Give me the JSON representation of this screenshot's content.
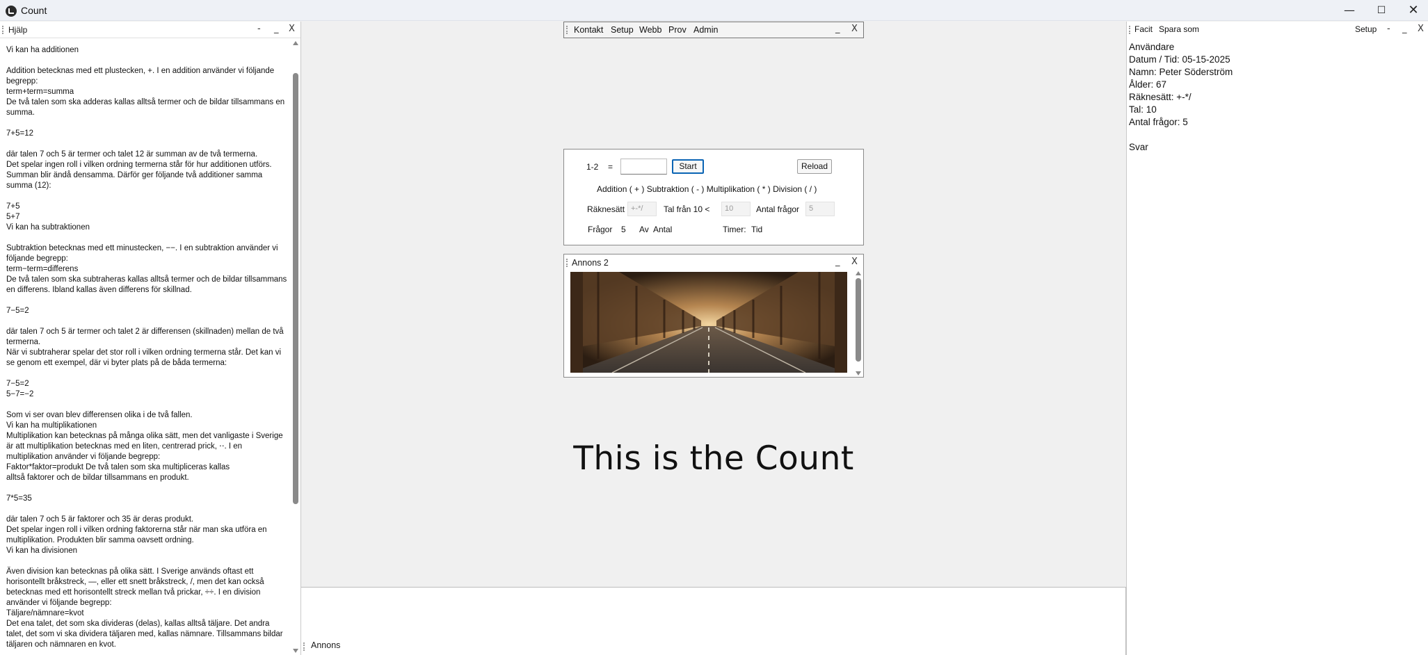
{
  "window": {
    "title": "Count",
    "minimize": "—",
    "maximize": "☐",
    "close": "✕"
  },
  "help_pane": {
    "title": "Hjälp",
    "controls": [
      "-",
      "_",
      "X"
    ],
    "text": "Vi kan ha additionen\n\nAddition betecknas med ett plustecken, +. I en addition använder vi följande begrepp:\nterm+term=summa\nDe två talen som ska adderas kallas alltså termer och de bildar tillsammans en summa.\n\n7+5=12\n\ndär talen 7 och 5 är termer och talet 12 är summan av de två termerna.\nDet spelar ingen roll i vilken ordning termerna står för hur additionen utförs. Summan blir ändå densamma. Därför ger följande två additioner samma summa (12):\n\n7+5\n5+7\nVi kan ha subtraktionen\n\nSubtraktion betecknas med ett minustecken, −−. I en subtraktion använder vi följande begrepp:\nterm−term=differens\nDe två talen som ska subtraheras kallas alltså termer och de bildar tillsammans en differens. Ibland kallas även differens för skillnad.\n\n7−5=2\n\ndär talen 7 och 5 är termer och talet 2 är differensen (skillnaden) mellan de två termerna.\nNär vi subtraherar spelar det stor roll i vilken ordning termerna står. Det kan vi se genom ett exempel, där vi byter plats på de båda termerna:\n\n7−5=2\n5−7=−2\n\nSom vi ser ovan blev differensen olika i de två fallen.\nVi kan ha multiplikationen\nMultiplikation kan betecknas på många olika sätt, men det vanligaste i Sverige är att multiplikation betecknas med en liten, centrerad prick, ⋅⋅. I en multiplikation använder vi följande begrepp:\nFaktor*faktor=produkt De två talen som ska multipliceras kallas\nalltså faktorer och de bildar tillsammans en produkt.\n\n7*5=35\n\ndär talen 7 och 5 är faktorer och 35 är deras produkt.\nDet spelar ingen roll i vilken ordning faktorerna står när man ska utföra en multiplikation. Produkten blir samma oavsett ordning.\nVi kan ha divisionen\n\nÄven division kan betecknas på olika sätt. I Sverige används oftast ett horisontellt bråkstreck, —, eller ett snett bråkstreck, /, men det kan också betecknas med ett horisontellt streck mellan två prickar, ÷÷. I en division använder vi följande begrepp:\nTäljare/nämnare=kvot\nDet ena talet, det som ska divideras (delas), kallas alltså täljare. Det andra talet, det som vi ska dividera täljaren med, kallas nämnare. Tillsammans bildar täljaren och nämnaren en kvot."
  },
  "menu_pane": {
    "items": [
      "Kontakt",
      "Setup",
      "Webb",
      "Prov",
      "Admin"
    ],
    "controls": [
      "_",
      "X"
    ]
  },
  "calc": {
    "question": "1-2",
    "equals": "=",
    "answer_value": "",
    "start_label": "Start",
    "reload_label": "Reload",
    "operations_line": "Addition ( + ) Subtraktion ( - ) Multiplikation ( * ) Division ( / )",
    "raknesatt_label": "Räknesätt",
    "raknesatt_value": "+-*/",
    "tal_fran_label": "Tal från 10 <",
    "tal_fran_value": "10",
    "antal_fragor_label": "Antal frågor",
    "antal_fragor_value": "5",
    "fragor_label": "Frågor",
    "fragor_value": "5",
    "av_label": "Av",
    "antal_label": "Antal",
    "timer_label": "Timer:",
    "tid_label": "Tid"
  },
  "ad2_pane": {
    "title": "Annons 2",
    "controls": [
      "_",
      "X"
    ]
  },
  "main_title": "This is the Count",
  "bottom_pane": {
    "title": "Annons"
  },
  "right_pane": {
    "menu": [
      "Facit",
      "Spara som"
    ],
    "setup_label": "Setup",
    "controls": [
      "-",
      "_",
      "X"
    ],
    "lines": [
      "Användare",
      "Datum / Tid: 05-15-2025",
      "Namn: Peter Söderström",
      "Ålder: 67",
      "Räknesätt: +-*/",
      "Tal: 10",
      "Antal frågor: 5",
      "",
      "Svar"
    ]
  }
}
